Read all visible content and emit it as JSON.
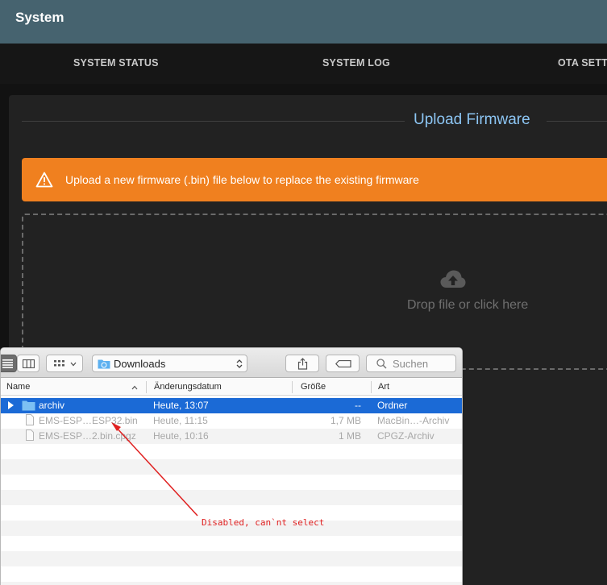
{
  "app": {
    "title": "System"
  },
  "tabs": [
    {
      "label": "SYSTEM STATUS"
    },
    {
      "label": "SYSTEM LOG"
    },
    {
      "label": "OTA SETT"
    }
  ],
  "upload": {
    "title": "Upload Firmware",
    "alert_text": "Upload a new firmware (.bin) file below to replace the existing firmware",
    "drop_text": "Drop file or click here"
  },
  "finder": {
    "location": "Downloads",
    "search_placeholder": "Suchen",
    "columns": {
      "name": "Name",
      "date": "Änderungsdatum",
      "size": "Größe",
      "kind": "Art"
    },
    "rows": [
      {
        "name": "archiv",
        "date": "Heute, 13:07",
        "size": "--",
        "kind": "Ordner",
        "state": "selected",
        "icon": "folder-icon"
      },
      {
        "name": "EMS-ESP…ESP32.bin",
        "date": "Heute, 11:15",
        "size": "1,7 MB",
        "kind": "MacBin…-Archiv",
        "state": "disabled",
        "icon": "document-icon"
      },
      {
        "name": "EMS-ESP…2.bin.cpgz",
        "date": "Heute, 10:16",
        "size": "1 MB",
        "kind": "CPGZ-Archiv",
        "state": "disabled",
        "icon": "document-icon"
      }
    ]
  },
  "annotation": {
    "text": "Disabled, can`nt select",
    "color": "#e02020"
  },
  "colors": {
    "appbar": "#46636f",
    "accent": "#8cc5f3",
    "alert": "#f0801f",
    "selection": "#1b6ad6"
  }
}
